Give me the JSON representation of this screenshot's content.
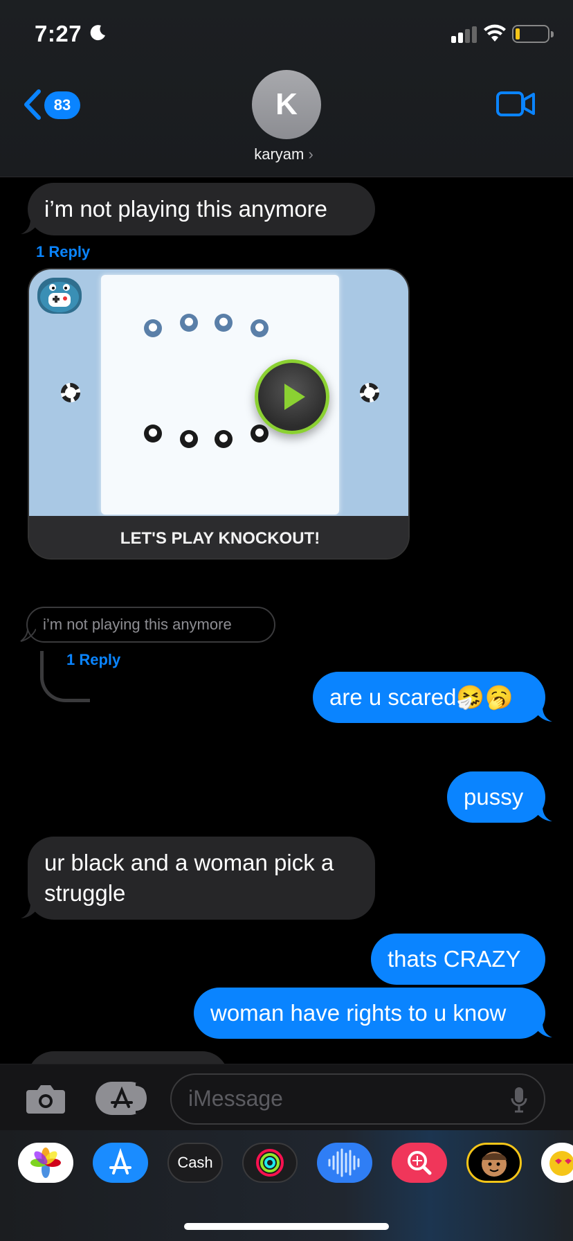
{
  "status_bar": {
    "time": "7:27",
    "focus_icon": "moon-icon",
    "signal_icon": "cellular-signal-icon",
    "wifi_icon": "wifi-icon",
    "battery_icon": "battery-low-icon",
    "battery_level": 0.12
  },
  "nav": {
    "back_icon": "chevron-left-icon",
    "unread_count": "83",
    "avatar_initial": "K",
    "contact_name": "karyam",
    "contact_chevron": "›",
    "video_icon": "video-camera-icon"
  },
  "messages": [
    {
      "text": "i’m not playing this anymore",
      "reply_label": "1 Reply"
    },
    {
      "game_caption": "LET'S PLAY KNOCKOUT!",
      "play_icon": "play-icon"
    },
    {
      "quoted_text": "i’m not playing this anymore",
      "reply_label": "1 Reply"
    },
    {
      "text": "are u scared🤧🥱"
    },
    {
      "text": "pussy"
    },
    {
      "text": "ur black and a woman pick a struggle"
    },
    {
      "text": "thats CRAZY"
    },
    {
      "text": "woman have rights to u know"
    }
  ],
  "input": {
    "camera_icon": "camera-icon",
    "apps_icon": "app-store-icon",
    "placeholder": "iMessage",
    "mic_icon": "microphone-icon"
  },
  "app_drawer": {
    "apps": [
      "photos-icon",
      "app-store-icon",
      "Cash",
      "activity-icon",
      "audio-message-icon",
      "search-icon",
      "memoji-icon",
      "emoji-sticker-icon"
    ],
    "cash_label": "Cash"
  },
  "colors": {
    "accent": "#0a84ff",
    "received_bubble": "#262628",
    "background": "#000000",
    "play_ring": "#8bd132"
  }
}
